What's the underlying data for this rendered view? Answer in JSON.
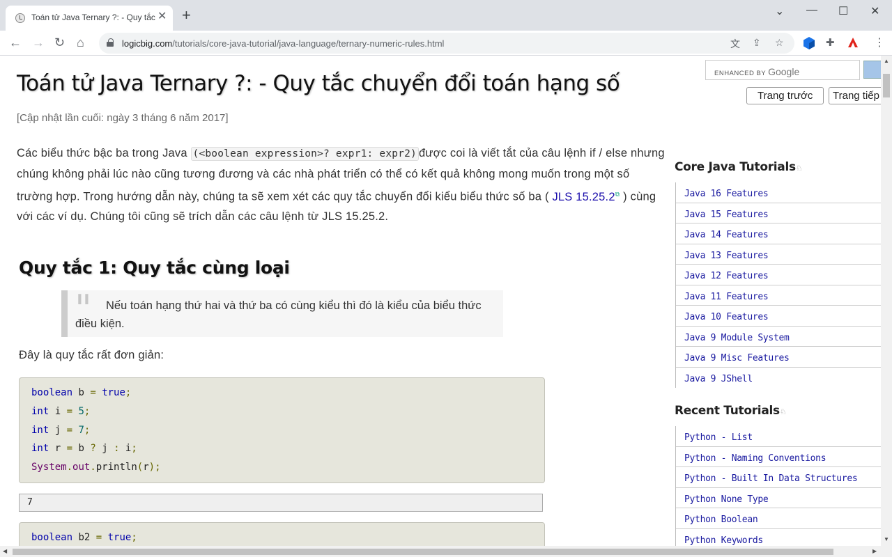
{
  "browser": {
    "tab_title": "Toán tử Java Ternary ?: - Quy tắc chuyển đổi toán hạng số",
    "url_host": "logicbig.com",
    "url_path": "/tutorials/core-java-tutorial/java-language/ternary-numeric-rules.html"
  },
  "article": {
    "title": "Toán tử Java Ternary ?: - Quy tắc chuyển đổi toán hạng số",
    "updated": "[Cập nhật lần cuối: ngày 3 tháng 6 năm 2017]",
    "intro_part1": "Các biểu thức bậc ba trong Java ",
    "intro_code": "(<boolean expression>? expr1: expr2)",
    "intro_part2": "được coi là viết tắt của câu lệnh if / else nhưng chúng không phải lúc nào cũng tương đương và các nhà phát triển có thể có kết quả không mong muốn trong một số trường hợp. Trong hướng dẫn này, chúng ta sẽ xem xét các quy tắc chuyển đổi kiểu biểu thức số ba ( ",
    "intro_link": "JLS 15.25.2",
    "intro_part3": " ) cùng với các ví dụ. Chúng tôi cũng sẽ trích dẫn các câu lệnh từ JLS 15.25.2.",
    "rule1_title": "Quy tắc 1: Quy tắc cùng loại",
    "rule1_quote": "Nếu toán hạng thứ hai và thứ ba có cùng kiểu thì đó là kiểu của biểu thức điều kiện.",
    "lead": "Đây là quy tắc rất đơn giản:",
    "output1": "7"
  },
  "sidebar": {
    "search_label": "ENHANCED BY",
    "search_brand": "Google",
    "prev_button": "Trang trước",
    "next_button": "Trang tiếp",
    "core_heading": "Core Java Tutorials",
    "core_items": [
      "Java 16 Features",
      "Java 15 Features",
      "Java 14 Features",
      "Java 13 Features",
      "Java 12 Features",
      "Java 11 Features",
      "Java 10 Features",
      "Java 9 Module System",
      "Java 9 Misc Features",
      "Java 9 JShell"
    ],
    "recent_heading": "Recent Tutorials",
    "recent_items": [
      "Python - List",
      "Python - Naming Conventions",
      "Python - Built In Data Structures",
      "Python None Type",
      "Python Boolean",
      "Python Keywords"
    ]
  },
  "icons": {
    "favicon": "logicbig-icon",
    "translate": "translate-icon",
    "share": "share-icon",
    "bookmark": "star-icon",
    "extensions": "puzzle-icon"
  }
}
